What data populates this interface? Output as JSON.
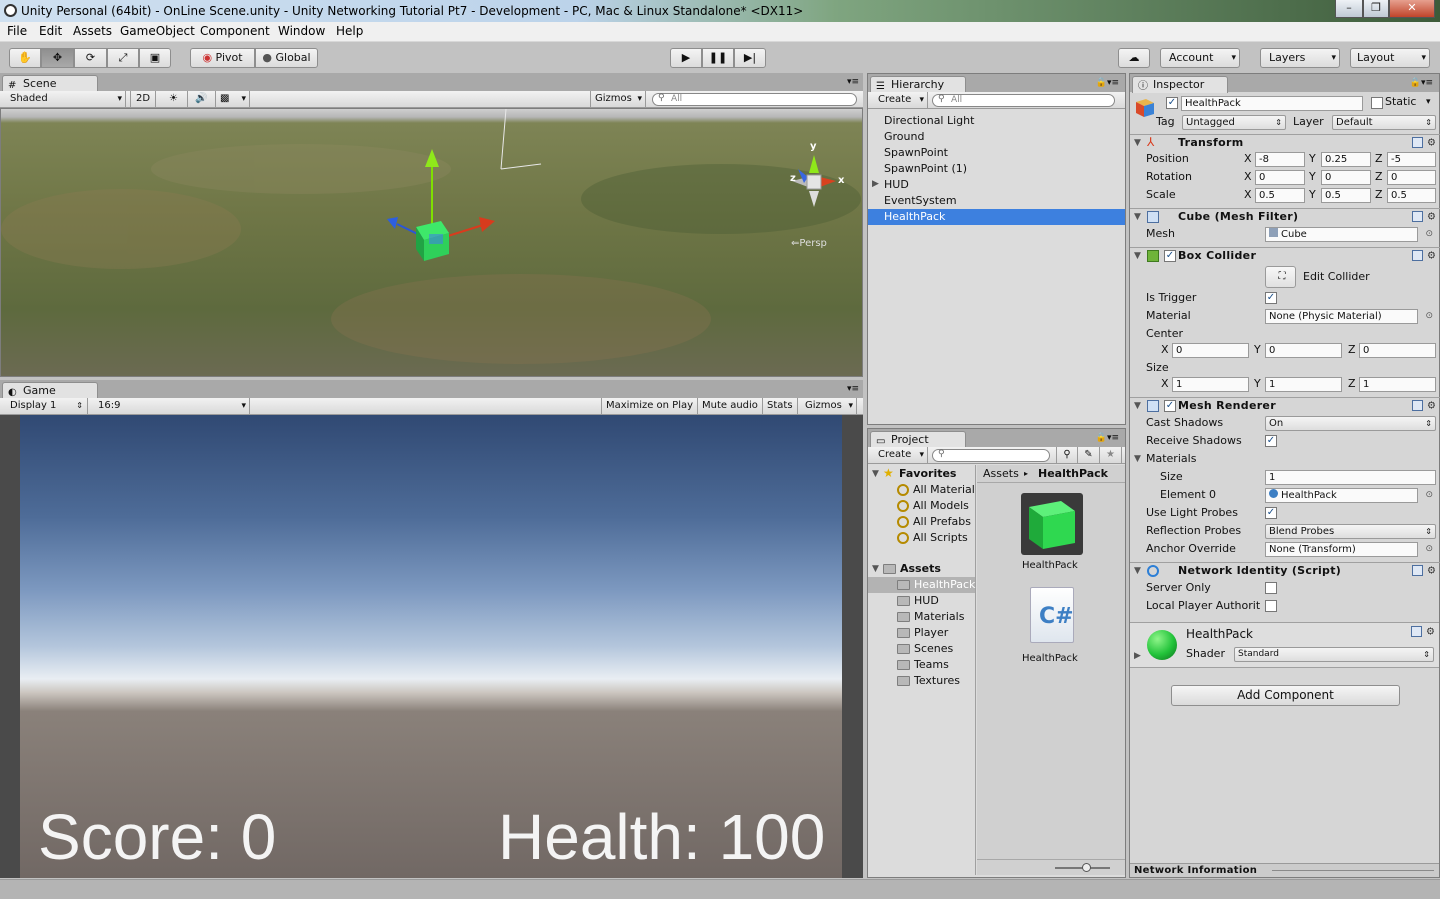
{
  "window": {
    "title": "Unity Personal (64bit) - OnLine Scene.unity - Unity Networking Tutorial Pt7 - Development - PC, Mac & Linux Standalone* <DX11>",
    "controls": [
      "–",
      "❐",
      "✕"
    ]
  },
  "menu": [
    "File",
    "Edit",
    "Assets",
    "GameObject",
    "Component",
    "Window",
    "Help"
  ],
  "toolbar": {
    "pivot": "Pivot",
    "global": "Global",
    "account": "Account",
    "layers": "Layers",
    "layout": "Layout"
  },
  "scene": {
    "tab": "Scene",
    "shading": "Shaded",
    "mode2d": "2D",
    "gizmos": "Gizmos",
    "search": "All",
    "gizmo_y": "y",
    "gizmo_x": "x",
    "gizmo_z": "z",
    "persp": "Persp"
  },
  "game": {
    "tab": "Game",
    "display": "Display 1",
    "aspect": "16:9",
    "maximize": "Maximize on Play",
    "mute": "Mute audio",
    "stats": "Stats",
    "gizmos": "Gizmos",
    "score": "Score: 0",
    "health": "Health: 100"
  },
  "hierarchy": {
    "tab": "Hierarchy",
    "create": "Create",
    "search": "All",
    "items": [
      "Directional Light",
      "Ground",
      "SpawnPoint",
      "SpawnPoint (1)",
      "HUD",
      "EventSystem",
      "HealthPack"
    ],
    "selected": "HealthPack"
  },
  "project": {
    "tab": "Project",
    "create": "Create",
    "favorites": "Favorites",
    "favorite_items": [
      "All Material",
      "All Models",
      "All Prefabs",
      "All Scripts"
    ],
    "assets_root": "Assets",
    "asset_folders": [
      "HealthPack",
      "HUD",
      "Materials",
      "Player",
      "Scenes",
      "Teams",
      "Textures"
    ],
    "breadcrumb_root": "Assets",
    "breadcrumb_current": "HealthPack",
    "files": [
      {
        "name": "HealthPack",
        "icon": "green-cube-icon"
      },
      {
        "name": "HealthPack",
        "icon": "csharp-script-icon"
      }
    ],
    "csharp_glyph": "C#"
  },
  "inspector": {
    "tab": "Inspector",
    "object_name": "HealthPack",
    "static": "Static",
    "tag_label": "Tag",
    "tag": "Untagged",
    "layer_label": "Layer",
    "layer": "Default",
    "transform": {
      "title": "Transform",
      "position_label": "Position",
      "rotation_label": "Rotation",
      "scale_label": "Scale",
      "position": {
        "x": "-8",
        "y": "0.25",
        "z": "-5"
      },
      "rotation": {
        "x": "0",
        "y": "0",
        "z": "0"
      },
      "scale": {
        "x": "0.5",
        "y": "0.5",
        "z": "0.5"
      }
    },
    "mesh_filter": {
      "title": "Cube (Mesh Filter)",
      "mesh_label": "Mesh",
      "mesh": "Cube"
    },
    "box_collider": {
      "title": "Box Collider",
      "edit": "Edit Collider",
      "trigger_label": "Is Trigger",
      "material_label": "Material",
      "material": "None (Physic Material)",
      "center_label": "Center",
      "center": {
        "x": "0",
        "y": "0",
        "z": "0"
      },
      "size_label": "Size",
      "size": {
        "x": "1",
        "y": "1",
        "z": "1"
      }
    },
    "mesh_renderer": {
      "title": "Mesh Renderer",
      "cast_label": "Cast Shadows",
      "cast": "On",
      "receive_label": "Receive Shadows",
      "materials_label": "Materials",
      "size_label": "Size",
      "size": "1",
      "element_label": "Element 0",
      "element": "HealthPack",
      "probes_label": "Use Light Probes",
      "reflection_label": "Reflection Probes",
      "reflection": "Blend Probes",
      "anchor_label": "Anchor Override",
      "anchor": "None (Transform)"
    },
    "network_identity": {
      "title": "Network Identity (Script)",
      "server_label": "Server Only",
      "local_label": "Local Player Authorit"
    },
    "material": {
      "name": "HealthPack",
      "shader_label": "Shader",
      "shader": "Standard"
    },
    "add_component": "Add Component",
    "network_info": "Network Information"
  }
}
